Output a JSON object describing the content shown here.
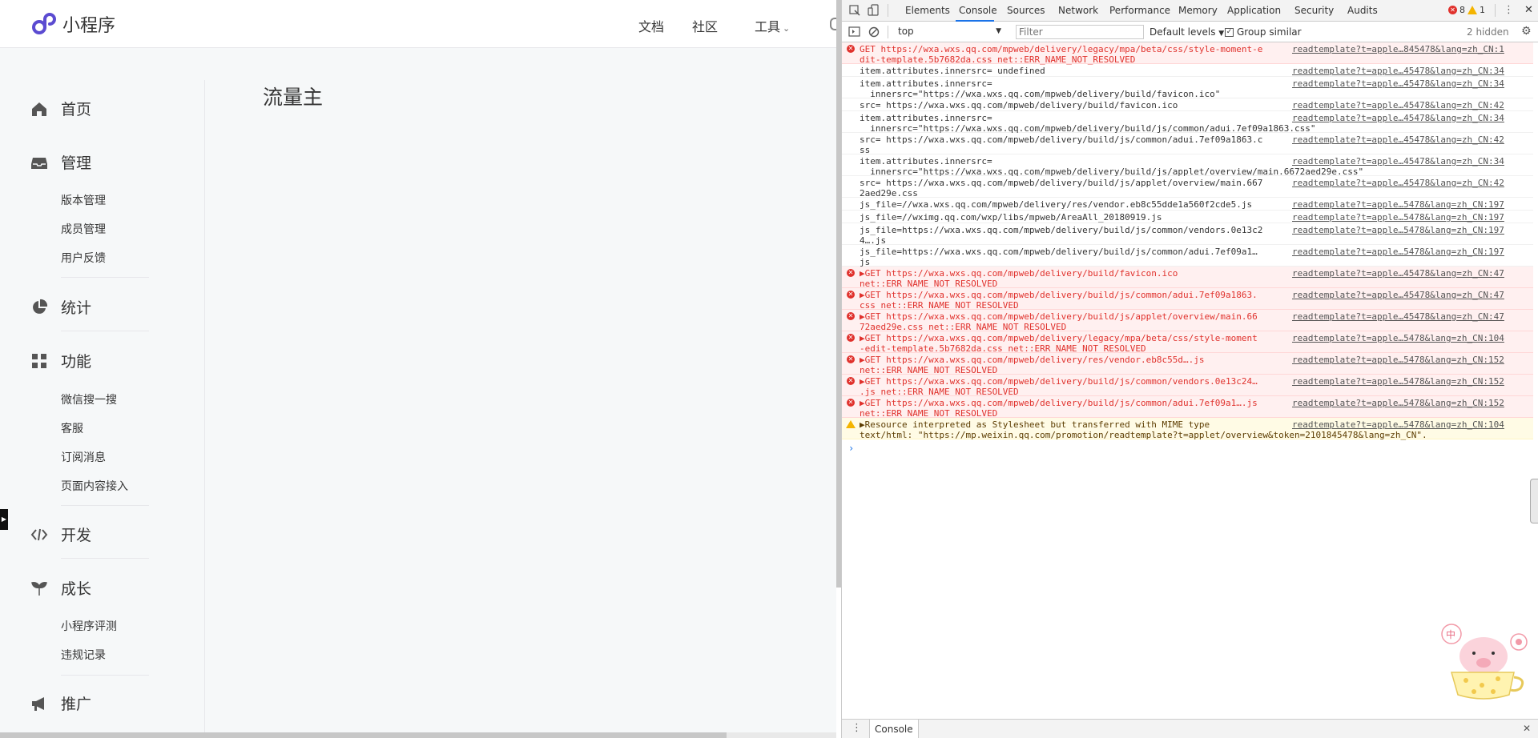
{
  "site": {
    "logo_text": "小程序",
    "nav": {
      "docs": "文档",
      "community": "社区",
      "tools": "工具"
    },
    "page_title": "流量主",
    "sidebar": {
      "home": "首页",
      "manage": "管理",
      "manage_items": [
        "版本管理",
        "成员管理",
        "用户反馈"
      ],
      "stats": "统计",
      "features": "功能",
      "feature_items": [
        "微信搜一搜",
        "客服",
        "订阅消息",
        "页面内容接入"
      ],
      "develop": "开发",
      "growth": "成长",
      "growth_items": [
        "小程序评测",
        "违规记录"
      ],
      "promote": "推广"
    },
    "icons": [
      "home-icon",
      "inbox-icon",
      "pie-chart-icon",
      "grid-icon",
      "code-icon",
      "sprout-icon",
      "megaphone-icon"
    ],
    "brand_color": "#5b4bd1"
  },
  "devtools": {
    "tabs": [
      "Elements",
      "Console",
      "Sources",
      "Network",
      "Performance",
      "Memory",
      "Application",
      "Security",
      "Audits"
    ],
    "active_tab": "Console",
    "error_count": "8",
    "warning_count": "1",
    "toolbar": {
      "context": "top",
      "filter_placeholder": "Filter",
      "levels": "Default levels",
      "group_similar": "Group similar",
      "hidden": "2 hidden"
    },
    "drawer_tab": "Console",
    "messages": [
      {
        "type": "error",
        "msg": "GET https://wxa.wxs.qq.com/mpweb/delivery/legacy/mpa/beta/css/style-moment-e\ndit-template.5b7682da.css net::ERR_NAME_NOT_RESOLVED",
        "src": "readtemplate?t=apple…845478&lang=zh_CN:1"
      },
      {
        "type": "log",
        "msg": "item.attributes.innersrc= undefined",
        "src": "readtemplate?t=apple…45478&lang=zh_CN:34"
      },
      {
        "type": "log",
        "msg": "item.attributes.innersrc=\n  innersrc=\"https://wxa.wxs.qq.com/mpweb/delivery/build/favicon.ico\"",
        "src": "readtemplate?t=apple…45478&lang=zh_CN:34"
      },
      {
        "type": "log",
        "msg": "src= https://wxa.wxs.qq.com/mpweb/delivery/build/favicon.ico",
        "src": "readtemplate?t=apple…45478&lang=zh_CN:42"
      },
      {
        "type": "log",
        "msg": "item.attributes.innersrc=\n  innersrc=\"https://wxa.wxs.qq.com/mpweb/delivery/build/js/common/adui.7ef09a1863.css\"",
        "src": "readtemplate?t=apple…45478&lang=zh_CN:34"
      },
      {
        "type": "log",
        "msg": "src= https://wxa.wxs.qq.com/mpweb/delivery/build/js/common/adui.7ef09a1863.c\nss",
        "src": "readtemplate?t=apple…45478&lang=zh_CN:42"
      },
      {
        "type": "log",
        "msg": "item.attributes.innersrc=\n  innersrc=\"https://wxa.wxs.qq.com/mpweb/delivery/build/js/applet/overview/main.6672aed29e.css\"",
        "src": "readtemplate?t=apple…45478&lang=zh_CN:34"
      },
      {
        "type": "log",
        "msg": "src= https://wxa.wxs.qq.com/mpweb/delivery/build/js/applet/overview/main.667\n2aed29e.css",
        "src": "readtemplate?t=apple…45478&lang=zh_CN:42"
      },
      {
        "type": "log",
        "msg": "js_file=//wxa.wxs.qq.com/mpweb/delivery/res/vendor.eb8c55dde1a560f2cde5.js",
        "src": "readtemplate?t=apple…5478&lang=zh_CN:197"
      },
      {
        "type": "log",
        "msg": "js_file=//wximg.qq.com/wxp/libs/mpweb/AreaAll_20180919.js",
        "src": "readtemplate?t=apple…5478&lang=zh_CN:197"
      },
      {
        "type": "log",
        "msg": "js_file=https://wxa.wxs.qq.com/mpweb/delivery/build/js/common/vendors.0e13c2\n4….js",
        "src": "readtemplate?t=apple…5478&lang=zh_CN:197"
      },
      {
        "type": "log",
        "msg": "js_file=https://wxa.wxs.qq.com/mpweb/delivery/build/js/common/adui.7ef09a1…\njs",
        "src": "readtemplate?t=apple…5478&lang=zh_CN:197"
      },
      {
        "type": "error",
        "msg": "▶GET https://wxa.wxs.qq.com/mpweb/delivery/build/favicon.ico\nnet::ERR_NAME_NOT_RESOLVED",
        "src": "readtemplate?t=apple…45478&lang=zh_CN:47"
      },
      {
        "type": "error",
        "msg": "▶GET https://wxa.wxs.qq.com/mpweb/delivery/build/js/common/adui.7ef09a1863.\ncss net::ERR_NAME_NOT_RESOLVED",
        "src": "readtemplate?t=apple…45478&lang=zh_CN:47"
      },
      {
        "type": "error",
        "msg": "▶GET https://wxa.wxs.qq.com/mpweb/delivery/build/js/applet/overview/main.66\n72aed29e.css net::ERR_NAME_NOT_RESOLVED",
        "src": "readtemplate?t=apple…45478&lang=zh_CN:47"
      },
      {
        "type": "error",
        "msg": "▶GET https://wxa.wxs.qq.com/mpweb/delivery/legacy/mpa/beta/css/style-moment\n-edit-template.5b7682da.css net::ERR_NAME_NOT_RESOLVED",
        "src": "readtemplate?t=apple…5478&lang=zh_CN:104"
      },
      {
        "type": "error",
        "msg": "▶GET https://wxa.wxs.qq.com/mpweb/delivery/res/vendor.eb8c55d….js\nnet::ERR_NAME_NOT_RESOLVED",
        "src": "readtemplate?t=apple…5478&lang=zh_CN:152"
      },
      {
        "type": "error",
        "msg": "▶GET https://wxa.wxs.qq.com/mpweb/delivery/build/js/common/vendors.0e13c24…\n.js net::ERR_NAME_NOT_RESOLVED",
        "src": "readtemplate?t=apple…5478&lang=zh_CN:152"
      },
      {
        "type": "error",
        "msg": "▶GET https://wxa.wxs.qq.com/mpweb/delivery/build/js/common/adui.7ef09a1….js\nnet::ERR_NAME_NOT_RESOLVED",
        "src": "readtemplate?t=apple…5478&lang=zh_CN:152"
      },
      {
        "type": "warning",
        "msg": "▶Resource interpreted as Stylesheet but transferred with MIME type\ntext/html: \"https://mp.weixin.qq.com/promotion/readtemplate?t=applet/overview&token=2101845478&lang=zh_CN\".",
        "src": "readtemplate?t=apple…5478&lang=zh_CN:104"
      }
    ]
  }
}
